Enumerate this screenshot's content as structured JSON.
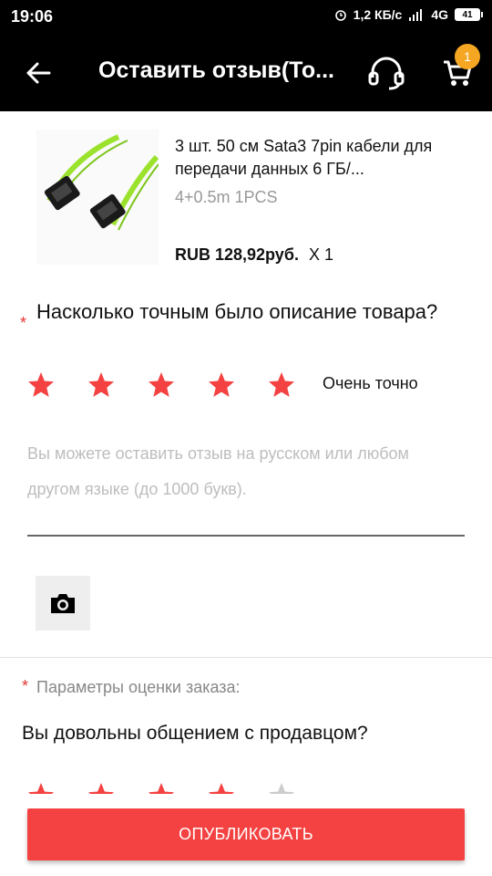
{
  "status_bar": {
    "time": "19:06",
    "net_speed": "1,2 КБ/с",
    "network": "4G",
    "battery": "41"
  },
  "app_bar": {
    "title": "Оставить отзыв(То...",
    "back_icon": "arrow-left-icon",
    "support_icon": "headset-icon",
    "cart_icon": "cart-icon",
    "cart_count": "1"
  },
  "product": {
    "title": "3 шт. 50 см Sata3 7pin кабели для передачи данных 6 ГБ/...",
    "variant": "4+0.5m 1PCS",
    "price": "RUB 128,92руб.",
    "quantity": "X 1"
  },
  "rating": {
    "required_mark": "*",
    "question": "Насколько точным было описание товара?",
    "stars": 5,
    "max_stars": 5,
    "label": "Очень точно"
  },
  "review": {
    "placeholder": "Вы можете оставить отзыв на русском или любом другом языке (до 1000 букв)."
  },
  "photo": {
    "icon": "camera-icon"
  },
  "params": {
    "required_mark": "*",
    "label": "Параметры оценки заказа:",
    "seller_question": "Вы довольны общением с продавцом?",
    "seller_stars": 4,
    "max_stars": 5
  },
  "publish_button": {
    "label": "ОПУБЛИКОВАТЬ"
  },
  "colors": {
    "accent": "#f44242",
    "star": "#f44242",
    "star_empty": "#cccccc",
    "badge": "#f5a623"
  }
}
